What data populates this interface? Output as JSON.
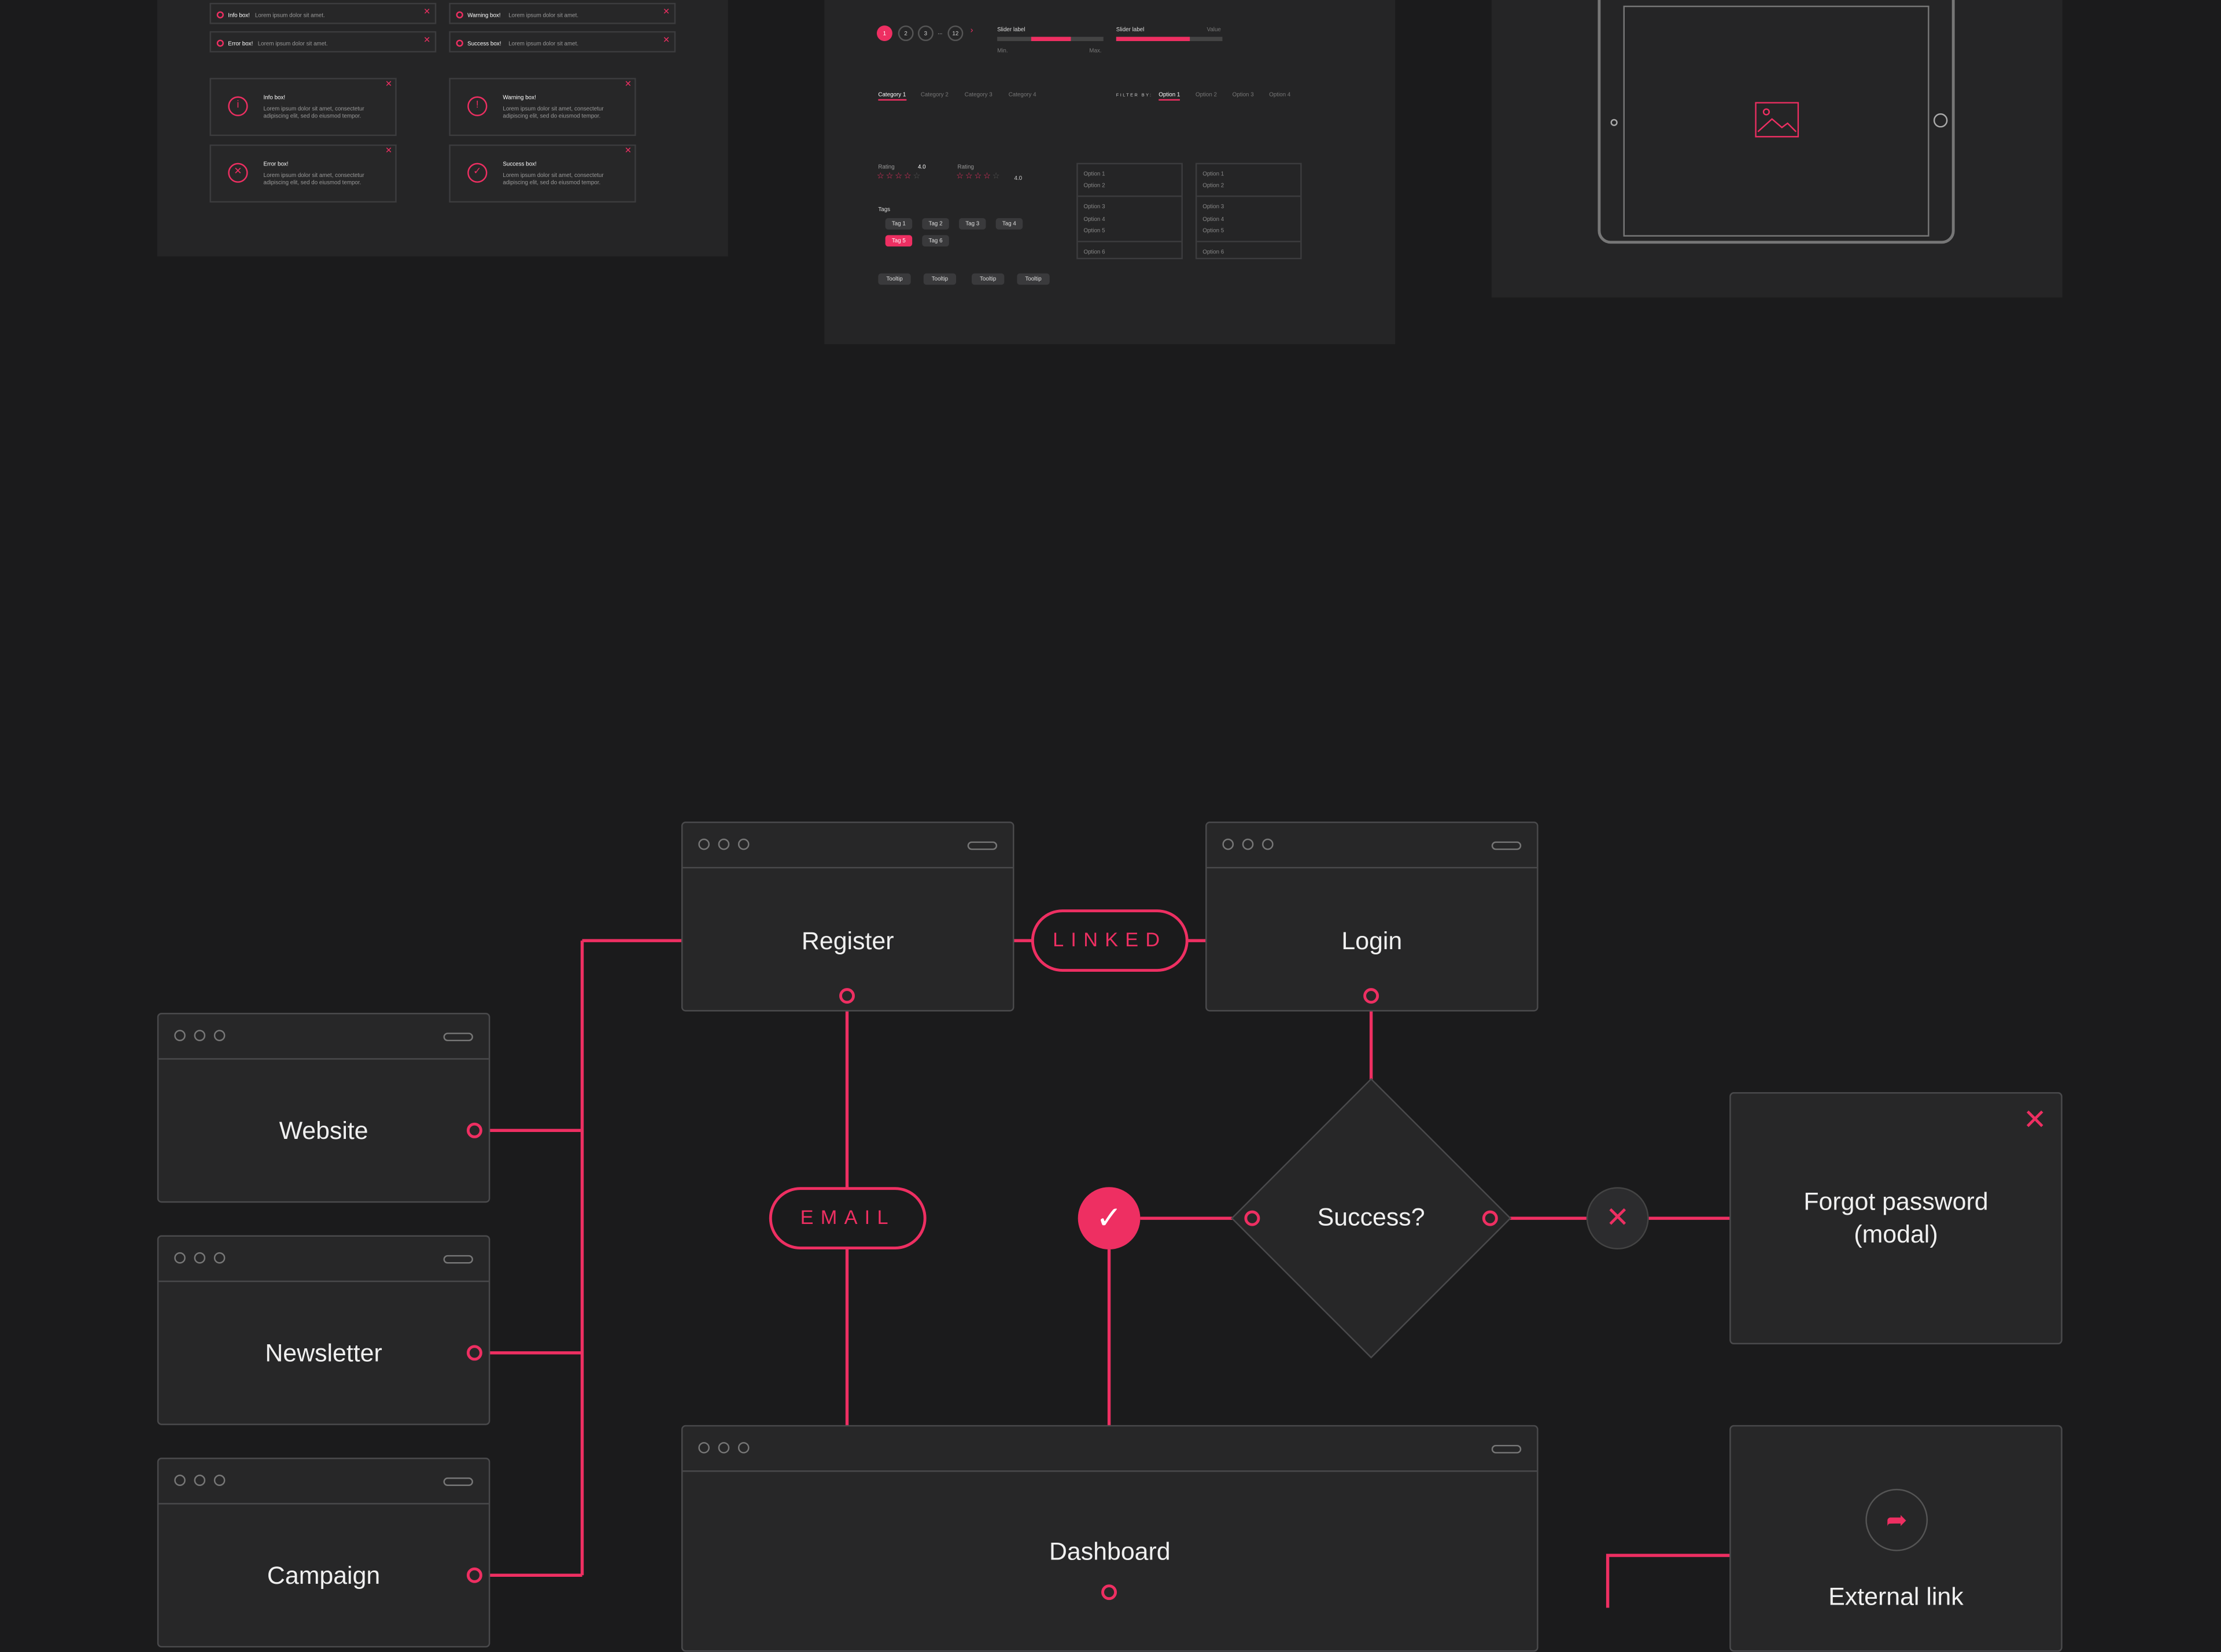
{
  "colors": {
    "accent": "#ee2f62",
    "background": "#1b1b1c",
    "panel": "#252526",
    "border": "#4a4a4c"
  },
  "alerts": {
    "inline": [
      {
        "title": "Info box!",
        "text": "Lorem ipsum dolor sit amet."
      },
      {
        "title": "Warning box!",
        "text": "Lorem ipsum dolor sit amet."
      },
      {
        "title": "Error box!",
        "text": "Lorem ipsum dolor sit amet."
      },
      {
        "title": "Success box!",
        "text": "Lorem ipsum dolor sit amet."
      }
    ],
    "cards": [
      {
        "title": "Info box!",
        "text": "Lorem ipsum dolor sit amet, consectetur adipiscing elit, sed do eiusmod tempor."
      },
      {
        "title": "Warning box!",
        "text": "Lorem ipsum dolor sit amet, consectetur adipiscing elit, sed do eiusmod tempor."
      },
      {
        "title": "Error box!",
        "text": "Lorem ipsum dolor sit amet, consectetur adipiscing elit, sed do eiusmod tempor."
      },
      {
        "title": "Success box!",
        "text": "Lorem ipsum dolor sit amet, consectetur adipiscing elit, sed do eiusmod tempor."
      }
    ]
  },
  "components": {
    "pagination": [
      "1",
      "2",
      "3",
      "...",
      "12",
      "›"
    ],
    "slider1": {
      "label": "Slider label",
      "min": "Min.",
      "max": "Max."
    },
    "slider2": {
      "label": "Slider label",
      "value": "Value"
    },
    "tabs": [
      "Category 1",
      "Category 2",
      "Category 3",
      "Category 4"
    ],
    "filter": {
      "label": "FILTER BY:",
      "options": [
        "Option 1",
        "Option 2",
        "Option 3",
        "Option 4"
      ]
    },
    "rating1": {
      "label": "Rating",
      "value": "4.0"
    },
    "rating2": {
      "label": "Rating",
      "value": "4.0"
    },
    "tags": {
      "label": "Tags",
      "items": [
        "Tag 1",
        "Tag 2",
        "Tag 3",
        "Tag 4",
        "Tag 5",
        "Tag 6"
      ]
    },
    "tooltips": [
      "Tooltip",
      "Tooltip",
      "Tooltip",
      "Tooltip"
    ],
    "list1": [
      "Option 1",
      "Option 2",
      "Option 3",
      "Option 4",
      "Option 5",
      "Option 6"
    ],
    "list2": [
      "Option 1",
      "Option 2",
      "Option 3",
      "Option 4",
      "Option 5",
      "Option 6"
    ]
  },
  "flow": {
    "register": "Register",
    "login": "Login",
    "website": "Website",
    "newsletter": "Newsletter",
    "campaign": "Campaign",
    "dashboard": "Dashboard",
    "linked": "LINKED",
    "email": "EMAIL",
    "decision": "Success?",
    "forgot_line1": "Forgot password",
    "forgot_line2": "(modal)",
    "external": "External link"
  }
}
